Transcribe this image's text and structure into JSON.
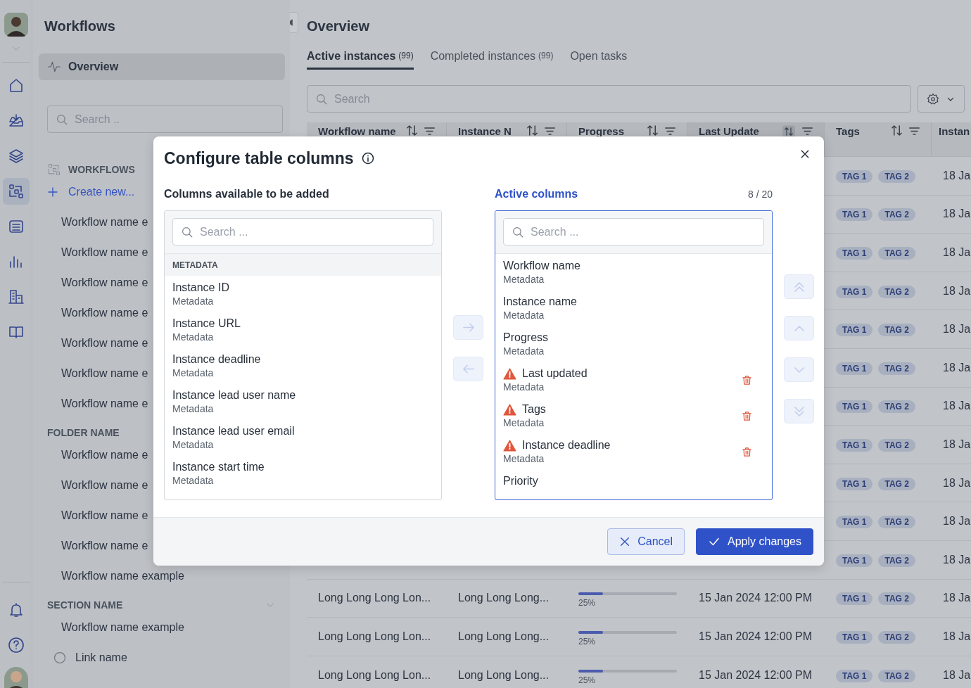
{
  "rail": {
    "items": [
      {
        "kind": "home",
        "selected": false
      },
      {
        "kind": "inbox",
        "selected": false
      },
      {
        "kind": "layers",
        "selected": false
      },
      {
        "kind": "workflow",
        "selected": true
      },
      {
        "kind": "list",
        "selected": false
      },
      {
        "kind": "chart",
        "selected": false
      },
      {
        "kind": "building",
        "selected": false
      },
      {
        "kind": "book",
        "selected": false
      }
    ],
    "bottom_items": [
      {
        "kind": "bell"
      },
      {
        "kind": "help"
      }
    ]
  },
  "nav": {
    "title": "Workflows",
    "overview": {
      "label": "Overview",
      "selected": true
    },
    "search": {
      "placeholder": "Search .."
    },
    "sections": [
      {
        "kind": "workflows",
        "title": "WORKFLOWS",
        "create": "Create new...",
        "items": [
          "Workflow name e",
          "Workflow name e",
          "Workflow name e",
          "Workflow name e",
          "Workflow name e",
          "Workflow name e",
          "Workflow name e"
        ]
      },
      {
        "kind": "folder",
        "title": "FOLDER NAME",
        "items": [
          "Workflow name e",
          "Workflow name e",
          "Workflow name e",
          "Workflow name e",
          "Workflow name example"
        ]
      },
      {
        "kind": "section",
        "title": "SECTION NAME",
        "items": [
          "Workflow name example"
        ],
        "links": [
          "Link name"
        ]
      }
    ]
  },
  "main": {
    "title": "Overview",
    "tabs": [
      {
        "label": "Active instances",
        "count": "(99)",
        "selected": true
      },
      {
        "label": "Completed instances",
        "count": "(99)",
        "selected": false
      },
      {
        "label": "Open tasks",
        "selected": false
      }
    ],
    "search": {
      "placeholder": "Search"
    },
    "table": {
      "columns": [
        {
          "label": "Workflow name",
          "selected": false
        },
        {
          "label": "Instance N",
          "selected": false
        },
        {
          "label": "Progress",
          "selected": false
        },
        {
          "label": "Last Update",
          "selected": true
        },
        {
          "label": "Tags",
          "selected": false
        },
        {
          "label": "Instan"
        }
      ],
      "rows": [
        {
          "tags": [
            "TAG 1",
            "TAG 2"
          ],
          "column_6": "18 Ja"
        },
        {
          "tags": [
            "TAG 1",
            "TAG 2"
          ],
          "column_6": "18 Ja"
        },
        {
          "tags": [
            "TAG 1",
            "TAG 2"
          ],
          "column_6": "18 Ja"
        },
        {
          "tags": [
            "TAG 1",
            "TAG 2"
          ],
          "column_6": "18 Ja"
        },
        {
          "tags": [
            "TAG 1",
            "TAG 2"
          ],
          "column_6": "18 Ja"
        },
        {
          "tags": [
            "TAG 1",
            "TAG 2"
          ],
          "column_6": "18 Ja"
        },
        {
          "tags": [
            "TAG 1",
            "TAG 2"
          ],
          "column_6": "18 Ja"
        },
        {
          "tags": [
            "TAG 1",
            "TAG 2"
          ],
          "column_6": "18 Ja"
        },
        {
          "tags": [
            "TAG 1",
            "TAG 2"
          ],
          "column_6": "18 Ja"
        },
        {
          "tags": [
            "TAG 1",
            "TAG 2"
          ],
          "column_6": "18 Ja"
        },
        {
          "tags": [
            "TAG 1",
            "TAG 2"
          ],
          "column_6": "18 Ja"
        },
        {
          "workflow_name": "Long Long Long Lon...",
          "instance_name": "Long Long Long...",
          "progress": {
            "level": 0.25,
            "label": "25%"
          },
          "last_update": "15 Jan 2024 12:00 PM",
          "tags": [
            "TAG 1",
            "TAG 2"
          ],
          "column_6": "18 Ja"
        },
        {
          "workflow_name": "Long Long Long Lon...",
          "instance_name": "Long Long Long...",
          "progress": {
            "level": 0.25,
            "label": "25%"
          },
          "last_update": "15 Jan 2024 12:00 PM",
          "tags": [
            "TAG 1",
            "TAG 2"
          ],
          "column_6": "18 Ja"
        },
        {
          "workflow_name": "Long Long Long Lon...",
          "instance_name": "Long Long Long...",
          "progress": {
            "level": 0.25,
            "label": "25%"
          },
          "last_update": "15 Jan 2024 12:00 PM",
          "tags": [
            "TAG 1",
            "TAG 2"
          ],
          "column_6": "18 Ja"
        }
      ]
    }
  },
  "dialog": {
    "title": "Configure table columns",
    "available": {
      "heading": "Columns available to be added",
      "search": {
        "placeholder": "Search ..."
      },
      "group": "METADATA",
      "items": [
        {
          "name": "Instance ID",
          "category": "Metadata"
        },
        {
          "name": "Instance URL",
          "category": "Metadata"
        },
        {
          "name": "Instance deadline",
          "category": "Metadata"
        },
        {
          "name": "Instance lead user name",
          "category": "Metadata"
        },
        {
          "name": "Instance lead user email",
          "category": "Metadata"
        },
        {
          "name": "Instance start time",
          "category": "Metadata"
        }
      ]
    },
    "transfer_buttons": [
      {
        "kind": "right",
        "disabled": true
      },
      {
        "kind": "left",
        "disabled": true
      }
    ],
    "active": {
      "heading": "Active columns",
      "count": "8 / 20",
      "search": {
        "placeholder": "Search ..."
      },
      "items": [
        {
          "name": "Workflow name",
          "category": "Metadata",
          "warning": false
        },
        {
          "name": "Instance name",
          "category": "Metadata",
          "warning": false
        },
        {
          "name": "Progress",
          "category": "Metadata",
          "warning": false
        },
        {
          "name": "Last updated",
          "category": "Metadata",
          "warning": true
        },
        {
          "name": "Tags",
          "category": "Metadata",
          "warning": true
        },
        {
          "name": "Instance deadline",
          "category": "Metadata",
          "warning": true
        },
        {
          "name": "Priority",
          "warning": false
        }
      ]
    },
    "order_buttons": [
      {
        "kind": "top",
        "disabled": true
      },
      {
        "kind": "up",
        "disabled": true
      },
      {
        "kind": "down",
        "disabled": true
      },
      {
        "kind": "bottom",
        "disabled": true
      }
    ],
    "buttons": [
      {
        "kind": "secondary",
        "label": "Cancel"
      },
      {
        "kind": "primary",
        "label": "Apply changes"
      }
    ]
  }
}
